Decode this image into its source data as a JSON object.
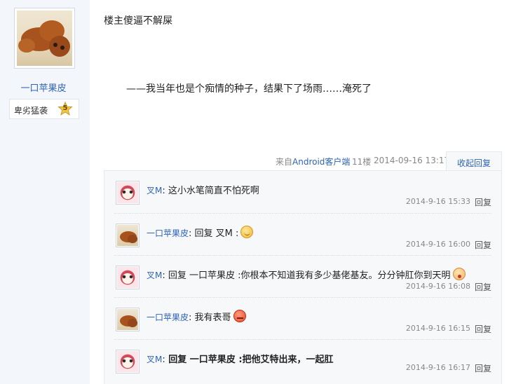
{
  "author": {
    "name": "一口苹果皮",
    "level_title": "卑劣猛袭",
    "level_number": "5"
  },
  "post": {
    "content": "楼主傻逼不解屎",
    "signature": "——我当年也是个痴情的种子，结果下了场雨……淹死了",
    "meta": {
      "source_prefix": "来自",
      "source_client": "Android客户端",
      "floor": "11楼",
      "time": "2014-09-16 13:17"
    },
    "collapse_label": "收起回复"
  },
  "replies": [
    {
      "user": "叉M",
      "colon": ":",
      "text": " 这小水笔简直不怕死啊",
      "time": "2014-9-16 15:33",
      "reply_label": "回复",
      "avatar": "cartoon-avatar"
    },
    {
      "user": "一口苹果皮",
      "colon": ":",
      "text": " 回复 叉M :",
      "time": "2014-9-16 16:00",
      "reply_label": "回复",
      "avatar": "poodle-avatar",
      "emoji": "smile-emoji"
    },
    {
      "user": "叉M",
      "colon": ":",
      "text": " 回复 一口苹果皮 :你根本不知道我有多少基佬基友。分分钟肛你到天明",
      "time": "2014-9-16 16:08",
      "reply_label": "回复",
      "avatar": "cartoon-avatar",
      "emoji": "shocked-emoji"
    },
    {
      "user": "一口苹果皮",
      "colon": ":",
      "text": " 我有表哥",
      "time": "2014-9-16 16:15",
      "reply_label": "回复",
      "avatar": "poodle-avatar",
      "emoji": "angry-emoji"
    },
    {
      "user": "叉M",
      "colon": ":",
      "text": " 回复 一口苹果皮 :把他艾特出来，一起肛",
      "time": "2014-9-16 16:17",
      "reply_label": "回复",
      "avatar": "cartoon-avatar"
    }
  ],
  "colors": {
    "link": "#2d64b3",
    "sidebar_bg": "#f3f6fb",
    "reply_bg": "#f7f8fa"
  }
}
